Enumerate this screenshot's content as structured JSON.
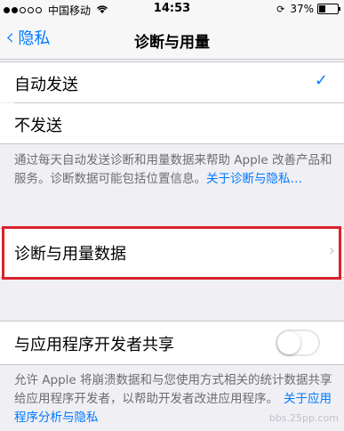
{
  "status_bar": {
    "carrier": "中国移动",
    "signal_dots_filled": 2,
    "signal_dots_total": 5,
    "time": "14:53",
    "battery_percent": "37%"
  },
  "nav": {
    "back_label": "隐私",
    "title": "诊断与用量"
  },
  "send_group": {
    "auto_send": "自动发送",
    "dont_send": "不发送",
    "selected": "自动发送",
    "footer_text": "通过每天自动发送诊断和用量数据来帮助 Apple 改善产品和服务。诊断数据可能包括位置信息。",
    "footer_link": "关于诊断与隐私…"
  },
  "data_row": {
    "label": "诊断与用量数据"
  },
  "share_group": {
    "label": "与应用程序开发者共享",
    "toggle_on": false,
    "footer_text": "允许 Apple 将崩溃数据和与您使用方式相关的统计数据共享给应用程序开发者，以帮助开发者改进应用程序。",
    "footer_link": "关于应用程序分析与隐私"
  },
  "watermark": "bbs.25pp.com",
  "colors": {
    "accent": "#007aff",
    "highlight": "#d8232a",
    "background": "#efeff4"
  }
}
